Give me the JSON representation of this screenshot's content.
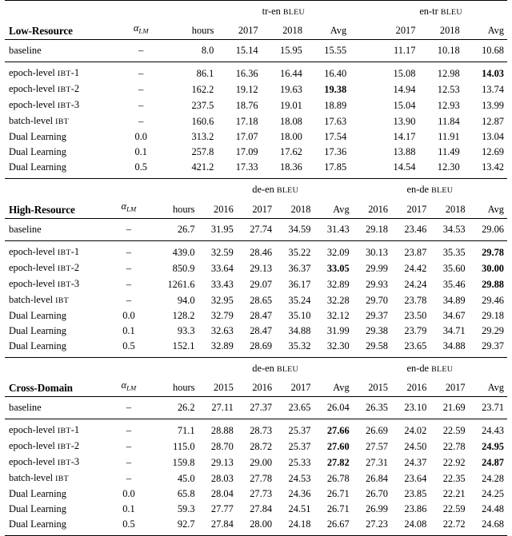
{
  "table": {
    "columns_meta": {
      "alpha_label": "α",
      "alpha_sub": "LM",
      "hours_label": "hours",
      "avg_label": "Avg",
      "bleu_label": "BLEU",
      "dash": "–"
    },
    "sections": [
      {
        "title": "Low-Resource",
        "groups": [
          {
            "name": "tr-en",
            "bleu": "BLEU",
            "years": [
              "2017",
              "2018"
            ],
            "avg": "Avg"
          },
          {
            "name": "en-tr",
            "bleu": "BLEU",
            "years": [
              "2017",
              "2018"
            ],
            "avg": "Avg"
          }
        ],
        "baseline": {
          "label": "baseline",
          "alpha": "–",
          "hours": "8.0",
          "values": [
            "15.14",
            "15.95",
            "15.55",
            "11.17",
            "10.18",
            "10.68"
          ],
          "bold": [
            false,
            false,
            false,
            false,
            false,
            false
          ]
        },
        "rows": [
          {
            "label_main": "epoch-level ",
            "label_sc": "IBT",
            "label_tail": "-1",
            "alpha": "–",
            "hours": "86.1",
            "values": [
              "16.36",
              "16.44",
              "16.40",
              "15.08",
              "12.98",
              "14.03"
            ],
            "bold": [
              false,
              false,
              false,
              false,
              false,
              true
            ]
          },
          {
            "label_main": "epoch-level ",
            "label_sc": "IBT",
            "label_tail": "-2",
            "alpha": "–",
            "hours": "162.2",
            "values": [
              "19.12",
              "19.63",
              "19.38",
              "14.94",
              "12.53",
              "13.74"
            ],
            "bold": [
              false,
              false,
              true,
              false,
              false,
              false
            ]
          },
          {
            "label_main": "epoch-level ",
            "label_sc": "IBT",
            "label_tail": "-3",
            "alpha": "–",
            "hours": "237.5",
            "values": [
              "18.76",
              "19.01",
              "18.89",
              "15.04",
              "12.93",
              "13.99"
            ],
            "bold": [
              false,
              false,
              false,
              false,
              false,
              false
            ]
          },
          {
            "label_main": "batch-level ",
            "label_sc": "IBT",
            "label_tail": "",
            "alpha": "–",
            "hours": "160.6",
            "values": [
              "17.18",
              "18.08",
              "17.63",
              "13.90",
              "11.84",
              "12.87"
            ],
            "bold": [
              false,
              false,
              false,
              false,
              false,
              false
            ]
          },
          {
            "label_main": "Dual Learning",
            "label_sc": "",
            "label_tail": "",
            "alpha": "0.0",
            "hours": "313.2",
            "values": [
              "17.07",
              "18.00",
              "17.54",
              "14.17",
              "11.91",
              "13.04"
            ],
            "bold": [
              false,
              false,
              false,
              false,
              false,
              false
            ]
          },
          {
            "label_main": "Dual Learning",
            "label_sc": "",
            "label_tail": "",
            "alpha": "0.1",
            "hours": "257.8",
            "values": [
              "17.09",
              "17.62",
              "17.36",
              "13.88",
              "11.49",
              "12.69"
            ],
            "bold": [
              false,
              false,
              false,
              false,
              false,
              false
            ]
          },
          {
            "label_main": "Dual Learning",
            "label_sc": "",
            "label_tail": "",
            "alpha": "0.5",
            "hours": "421.2",
            "values": [
              "17.33",
              "18.36",
              "17.85",
              "14.54",
              "12.30",
              "13.42"
            ],
            "bold": [
              false,
              false,
              false,
              false,
              false,
              false
            ]
          }
        ]
      },
      {
        "title": "High-Resource",
        "groups": [
          {
            "name": "de-en",
            "bleu": "BLEU",
            "years": [
              "2016",
              "2017",
              "2018"
            ],
            "avg": "Avg"
          },
          {
            "name": "en-de",
            "bleu": "BLEU",
            "years": [
              "2016",
              "2017",
              "2018"
            ],
            "avg": "Avg"
          }
        ],
        "baseline": {
          "label": "baseline",
          "alpha": "–",
          "hours": "26.7",
          "values": [
            "31.95",
            "27.74",
            "34.59",
            "31.43",
            "29.18",
            "23.46",
            "34.53",
            "29.06"
          ],
          "bold": [
            false,
            false,
            false,
            false,
            false,
            false,
            false,
            false
          ]
        },
        "rows": [
          {
            "label_main": "epoch-level ",
            "label_sc": "IBT",
            "label_tail": "-1",
            "alpha": "–",
            "hours": "439.0",
            "values": [
              "32.59",
              "28.46",
              "35.22",
              "32.09",
              "30.13",
              "23.87",
              "35.35",
              "29.78"
            ],
            "bold": [
              false,
              false,
              false,
              false,
              false,
              false,
              false,
              true
            ]
          },
          {
            "label_main": "epoch-level ",
            "label_sc": "IBT",
            "label_tail": "-2",
            "alpha": "–",
            "hours": "850.9",
            "values": [
              "33.64",
              "29.13",
              "36.37",
              "33.05",
              "29.99",
              "24.42",
              "35.60",
              "30.00"
            ],
            "bold": [
              false,
              false,
              false,
              true,
              false,
              false,
              false,
              true
            ]
          },
          {
            "label_main": "epoch-level ",
            "label_sc": "IBT",
            "label_tail": "-3",
            "alpha": "–",
            "hours": "1261.6",
            "values": [
              "33.43",
              "29.07",
              "36.17",
              "32.89",
              "29.93",
              "24.24",
              "35.46",
              "29.88"
            ],
            "bold": [
              false,
              false,
              false,
              false,
              false,
              false,
              false,
              true
            ]
          },
          {
            "label_main": "batch-level ",
            "label_sc": "IBT",
            "label_tail": "",
            "alpha": "–",
            "hours": "94.0",
            "values": [
              "32.95",
              "28.65",
              "35.24",
              "32.28",
              "29.70",
              "23.78",
              "34.89",
              "29.46"
            ],
            "bold": [
              false,
              false,
              false,
              false,
              false,
              false,
              false,
              false
            ]
          },
          {
            "label_main": "Dual Learning",
            "label_sc": "",
            "label_tail": "",
            "alpha": "0.0",
            "hours": "128.2",
            "values": [
              "32.79",
              "28.47",
              "35.10",
              "32.12",
              "29.37",
              "23.50",
              "34.67",
              "29.18"
            ],
            "bold": [
              false,
              false,
              false,
              false,
              false,
              false,
              false,
              false
            ]
          },
          {
            "label_main": "Dual Learning",
            "label_sc": "",
            "label_tail": "",
            "alpha": "0.1",
            "hours": "93.3",
            "values": [
              "32.63",
              "28.47",
              "34.88",
              "31.99",
              "29.38",
              "23.79",
              "34.71",
              "29.29"
            ],
            "bold": [
              false,
              false,
              false,
              false,
              false,
              false,
              false,
              false
            ]
          },
          {
            "label_main": "Dual Learning",
            "label_sc": "",
            "label_tail": "",
            "alpha": "0.5",
            "hours": "152.1",
            "values": [
              "32.89",
              "28.69",
              "35.32",
              "32.30",
              "29.58",
              "23.65",
              "34.88",
              "29.37"
            ],
            "bold": [
              false,
              false,
              false,
              false,
              false,
              false,
              false,
              false
            ]
          }
        ]
      },
      {
        "title": "Cross-Domain",
        "groups": [
          {
            "name": "de-en",
            "bleu": "BLEU",
            "years": [
              "2015",
              "2016",
              "2017"
            ],
            "avg": "Avg"
          },
          {
            "name": "en-de",
            "bleu": "BLEU",
            "years": [
              "2015",
              "2016",
              "2017"
            ],
            "avg": "Avg"
          }
        ],
        "baseline": {
          "label": "baseline",
          "alpha": "–",
          "hours": "26.2",
          "values": [
            "27.11",
            "27.37",
            "23.65",
            "26.04",
            "26.35",
            "23.10",
            "21.69",
            "23.71"
          ],
          "bold": [
            false,
            false,
            false,
            false,
            false,
            false,
            false,
            false
          ]
        },
        "rows": [
          {
            "label_main": "epoch-level ",
            "label_sc": "IBT",
            "label_tail": "-1",
            "alpha": "–",
            "hours": "71.1",
            "values": [
              "28.88",
              "28.73",
              "25.37",
              "27.66",
              "26.69",
              "24.02",
              "22.59",
              "24.43"
            ],
            "bold": [
              false,
              false,
              false,
              true,
              false,
              false,
              false,
              false
            ]
          },
          {
            "label_main": "epoch-level ",
            "label_sc": "IBT",
            "label_tail": "-2",
            "alpha": "–",
            "hours": "115.0",
            "values": [
              "28.70",
              "28.72",
              "25.37",
              "27.60",
              "27.57",
              "24.50",
              "22.78",
              "24.95"
            ],
            "bold": [
              false,
              false,
              false,
              true,
              false,
              false,
              false,
              true
            ]
          },
          {
            "label_main": "epoch-level ",
            "label_sc": "IBT",
            "label_tail": "-3",
            "alpha": "–",
            "hours": "159.8",
            "values": [
              "29.13",
              "29.00",
              "25.33",
              "27.82",
              "27.31",
              "24.37",
              "22.92",
              "24.87"
            ],
            "bold": [
              false,
              false,
              false,
              true,
              false,
              false,
              false,
              true
            ]
          },
          {
            "label_main": "batch-level ",
            "label_sc": "IBT",
            "label_tail": "",
            "alpha": "–",
            "hours": "45.0",
            "values": [
              "28.03",
              "27.78",
              "24.53",
              "26.78",
              "26.84",
              "23.64",
              "22.35",
              "24.28"
            ],
            "bold": [
              false,
              false,
              false,
              false,
              false,
              false,
              false,
              false
            ]
          },
          {
            "label_main": "Dual Learning",
            "label_sc": "",
            "label_tail": "",
            "alpha": "0.0",
            "hours": "65.8",
            "values": [
              "28.04",
              "27.73",
              "24.36",
              "26.71",
              "26.70",
              "23.85",
              "22.21",
              "24.25"
            ],
            "bold": [
              false,
              false,
              false,
              false,
              false,
              false,
              false,
              false
            ]
          },
          {
            "label_main": "Dual Learning",
            "label_sc": "",
            "label_tail": "",
            "alpha": "0.1",
            "hours": "59.3",
            "values": [
              "27.77",
              "27.84",
              "24.51",
              "26.71",
              "26.99",
              "23.86",
              "22.59",
              "24.48"
            ],
            "bold": [
              false,
              false,
              false,
              false,
              false,
              false,
              false,
              false
            ]
          },
          {
            "label_main": "Dual Learning",
            "label_sc": "",
            "label_tail": "",
            "alpha": "0.5",
            "hours": "92.7",
            "values": [
              "27.84",
              "28.00",
              "24.18",
              "26.67",
              "27.23",
              "24.08",
              "22.72",
              "24.68"
            ],
            "bold": [
              false,
              false,
              false,
              false,
              false,
              false,
              false,
              false
            ]
          }
        ]
      }
    ]
  }
}
